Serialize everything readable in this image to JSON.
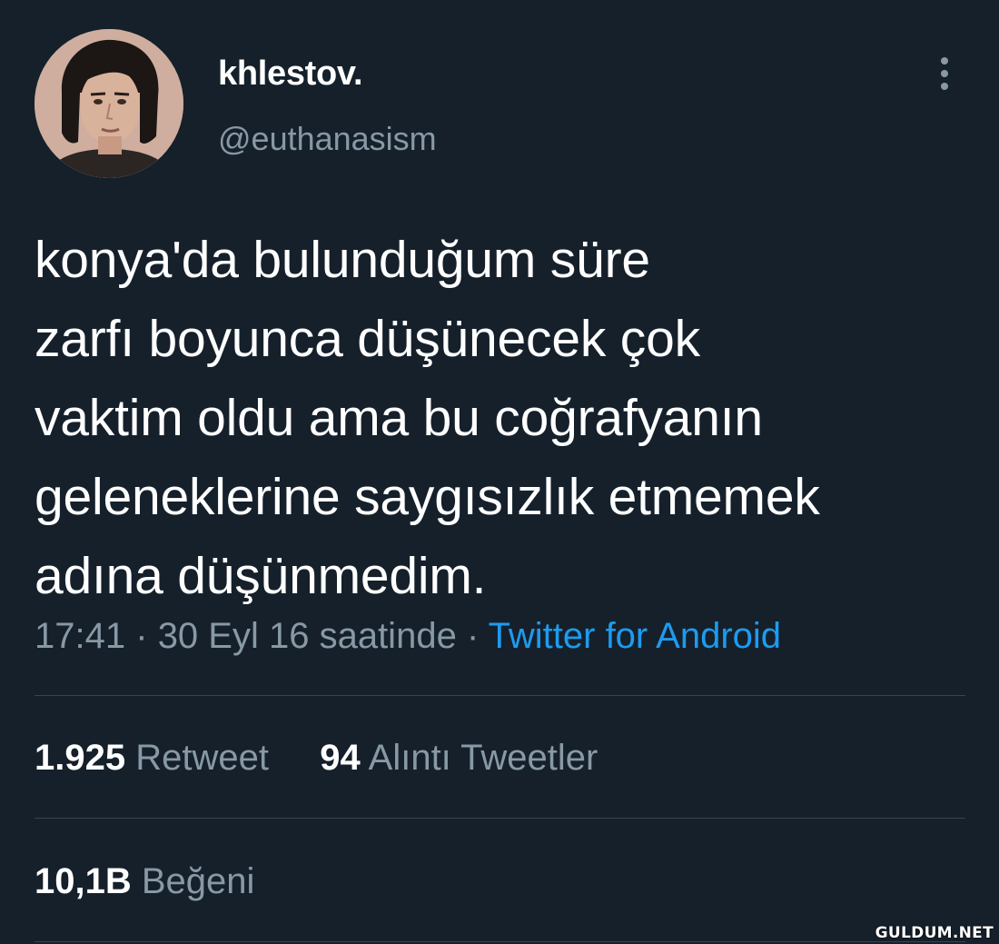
{
  "user": {
    "display_name": "khlestov.",
    "handle": "@euthanasism",
    "avatar": "profile-photo"
  },
  "tweet": {
    "text": "konya'da bulunduğum süre\nzarfı boyunca düşünecek çok\nvaktim oldu ama bu coğrafyanın\ngeleneklerine saygısızlık etmemek\nadına düşünmedim.",
    "time": "17:41",
    "separator": "·",
    "date": "30 Eyl 16 saatinde",
    "source": "Twitter for Android"
  },
  "stats": {
    "retweets_count": "1.925",
    "retweets_label": "Retweet",
    "quotes_count": "94",
    "quotes_label": "Alıntı Tweetler",
    "likes_count": "10,1B",
    "likes_label": "Beğeni"
  },
  "watermark": "GULDUM.NET",
  "colors": {
    "background": "#15202b",
    "primary_text": "#ffffff",
    "secondary_text": "#8899a6",
    "link": "#1d9bf0",
    "divider": "#38444d"
  },
  "icons": {
    "more": "more-vertical-icon"
  }
}
